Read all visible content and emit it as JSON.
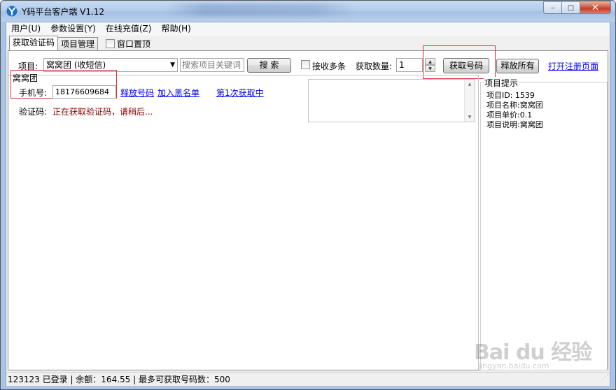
{
  "window": {
    "title": "Y码平台客户端 V1.12",
    "minimize_glyph": "–",
    "maximize_glyph": "□",
    "close_glyph": "✕"
  },
  "menu": [
    {
      "label": "用户(U)"
    },
    {
      "label": "参数设置(Y)"
    },
    {
      "label": "在线充值(Z)"
    },
    {
      "label": "帮助(H)"
    }
  ],
  "tabs": [
    {
      "label": "获取验证码",
      "active": true
    },
    {
      "label": "项目管理",
      "active": false
    }
  ],
  "pin_window_label": "窗口置顶",
  "toolbar": {
    "project_label": "项目:",
    "project_value": "窝窝团 (收短信)",
    "search_placeholder": "搜索项目关键词",
    "search_button": "搜 索",
    "multi_receive_label": "接收多条",
    "count_label": "获取数量:",
    "count_value": "1",
    "get_number_button": "获取号码",
    "release_all_button": "释放所有",
    "open_register_link": "打开注册页面"
  },
  "entry": {
    "project_name": "窝窝团",
    "phone_label": "手机号:",
    "phone_value": "18176609684",
    "release_link": "释放号码",
    "blacklist_link": "加入黑名单",
    "status_link": "第1次获取中",
    "code_label": "验证码:",
    "code_status": "正在获取验证码，请稍后..."
  },
  "hints": {
    "title": "项目提示",
    "lines": [
      "项目ID: 1539",
      "项目名称:窝窝团",
      "项目单价:0.1",
      "项目说明:窝窝团"
    ]
  },
  "status": {
    "text": "123123 已登录  |  余额：164.55  |  最多可获取号码数：500"
  },
  "watermark": {
    "main": "Bai du 经验",
    "sub": "jingyan.baidu.com"
  },
  "colors": {
    "link": "#0000ee",
    "highlight_box": "#d9363e",
    "code_status": "#8b0000"
  }
}
